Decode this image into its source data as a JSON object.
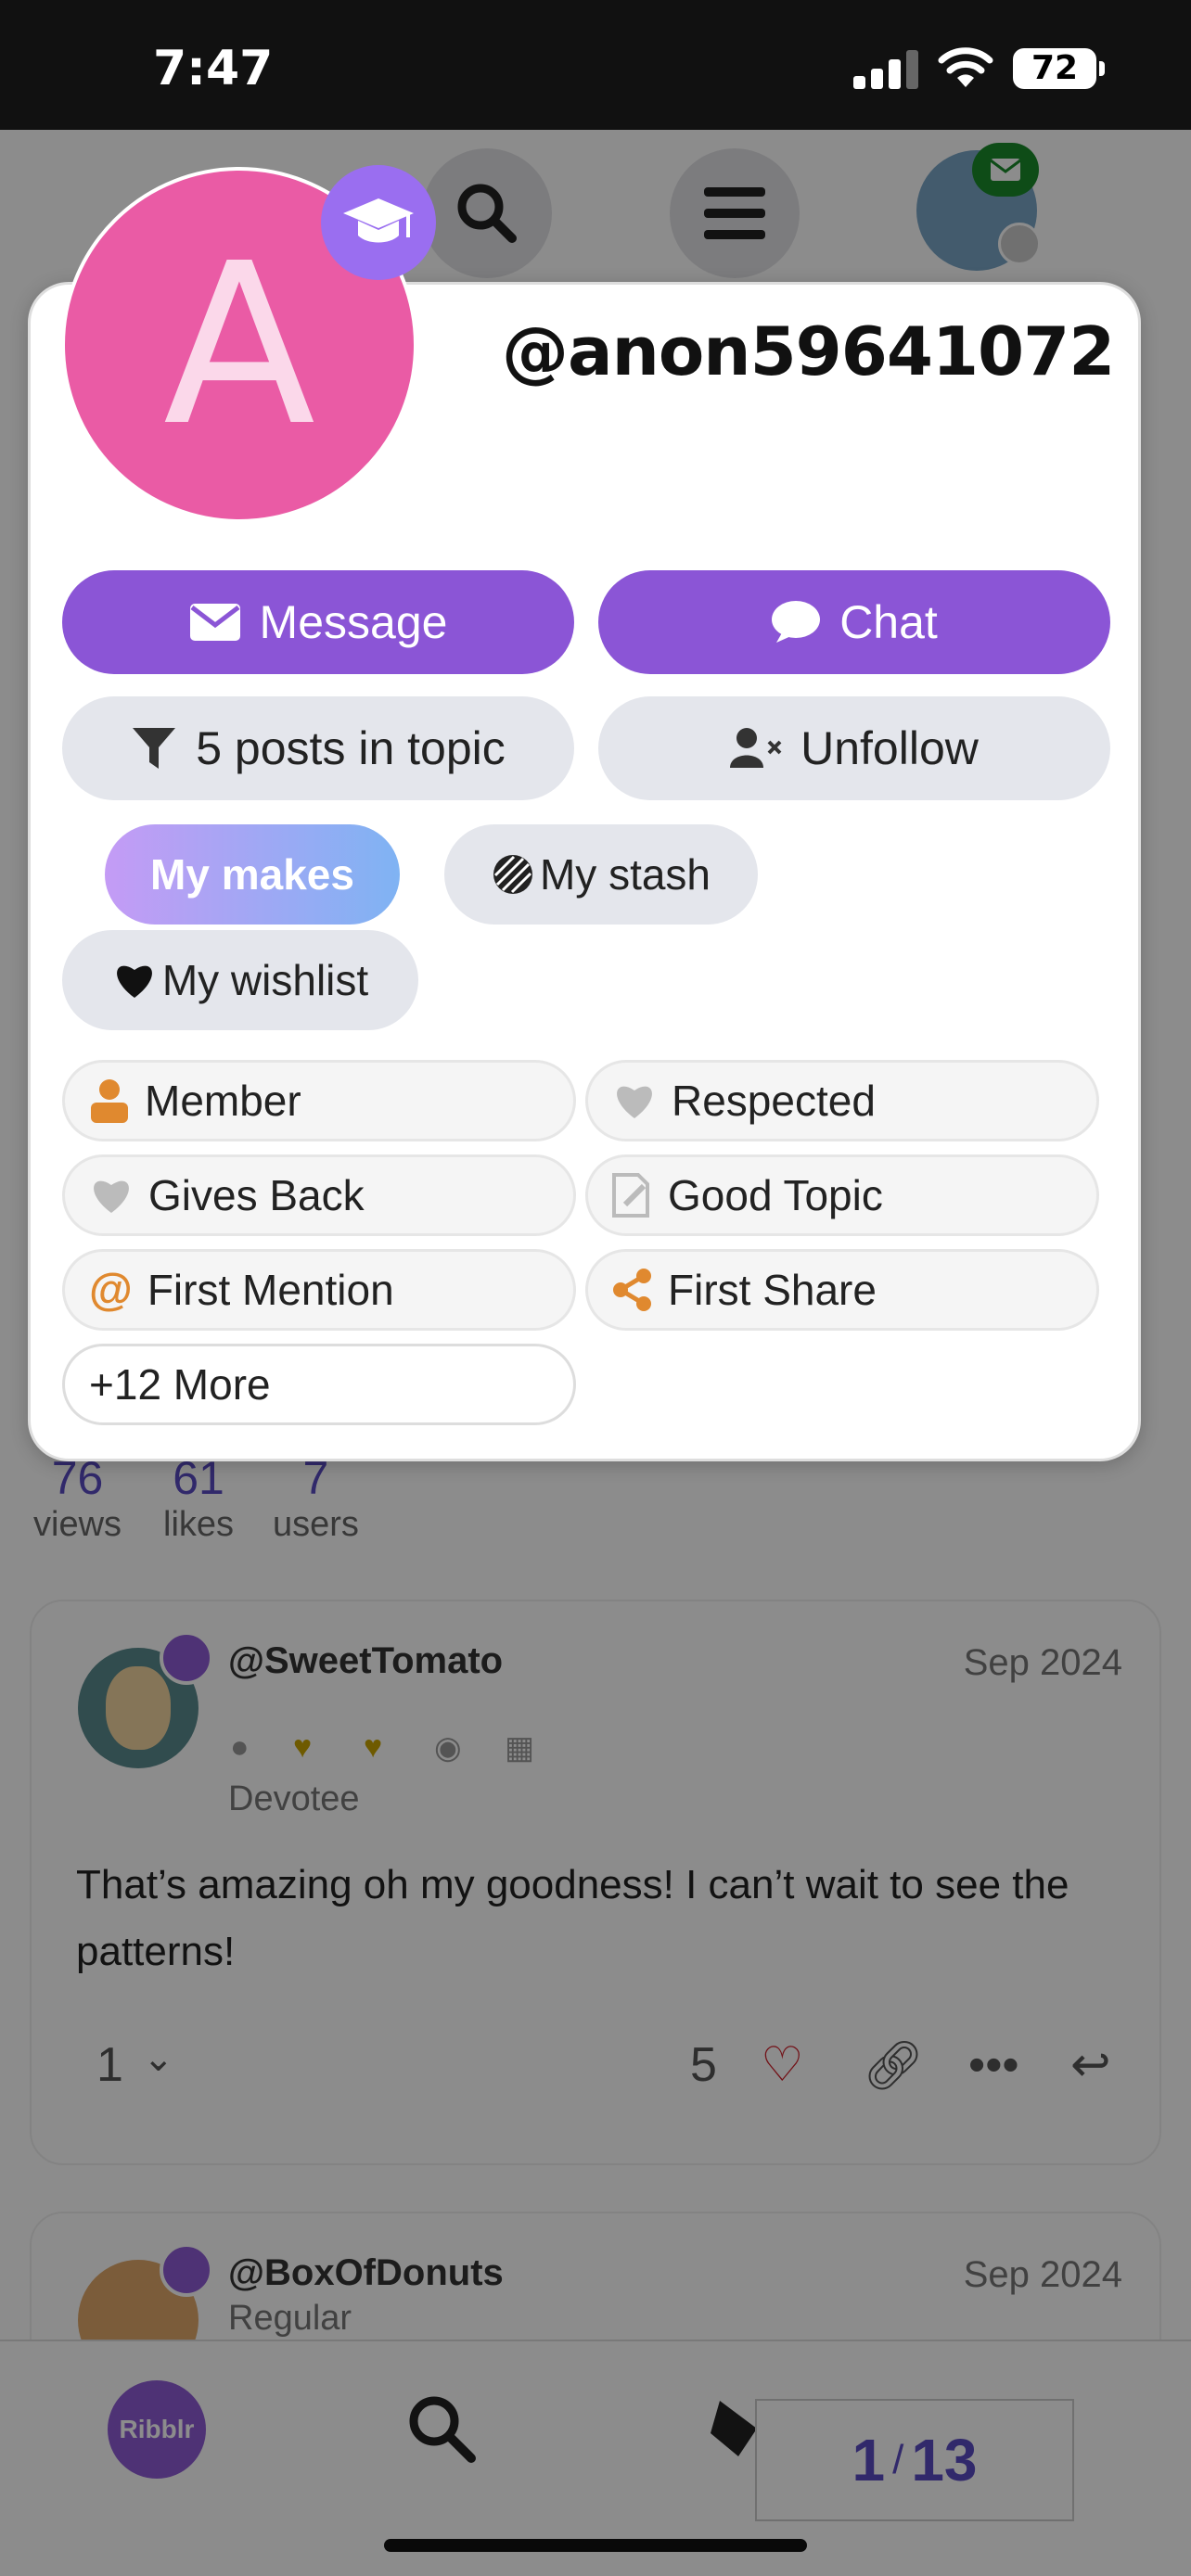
{
  "status_bar": {
    "time": "7:47",
    "battery": "72"
  },
  "profile_card": {
    "avatar_letter": "A",
    "username": "@anon59641072",
    "buttons": {
      "message": "Message",
      "chat": "Chat",
      "posts_in_topic": "5 posts in topic",
      "unfollow": "Unfollow",
      "my_makes": "My makes",
      "my_stash": "My stash",
      "my_wishlist": "My wishlist"
    },
    "badges": [
      "Member",
      "Respected",
      "Gives Back",
      "Good Topic",
      "First Mention",
      "First Share"
    ],
    "more_badges": "+12 More"
  },
  "topic_stats": {
    "views": {
      "value": "76",
      "label": "views"
    },
    "likes": {
      "value": "61",
      "label": "likes"
    },
    "users": {
      "value": "7",
      "label": "users"
    }
  },
  "posts": [
    {
      "username": "@SweetTomato",
      "date": "Sep 2024",
      "title": "Devotee",
      "body": "That’s amazing oh my goodness! I can’t wait to see the patterns!",
      "replies": "1",
      "likes": "5"
    },
    {
      "username": "@BoxOfDonuts",
      "date": "Sep 2024",
      "title": "Regular"
    }
  ],
  "bottom_nav": {
    "logo_text": "Ribblr"
  },
  "progress": {
    "current": "1",
    "separator": "/",
    "total": "13"
  },
  "colors": {
    "accent": "#8b55d6",
    "avatar": "#ea5ba5",
    "badge_orange": "#e0892f"
  }
}
